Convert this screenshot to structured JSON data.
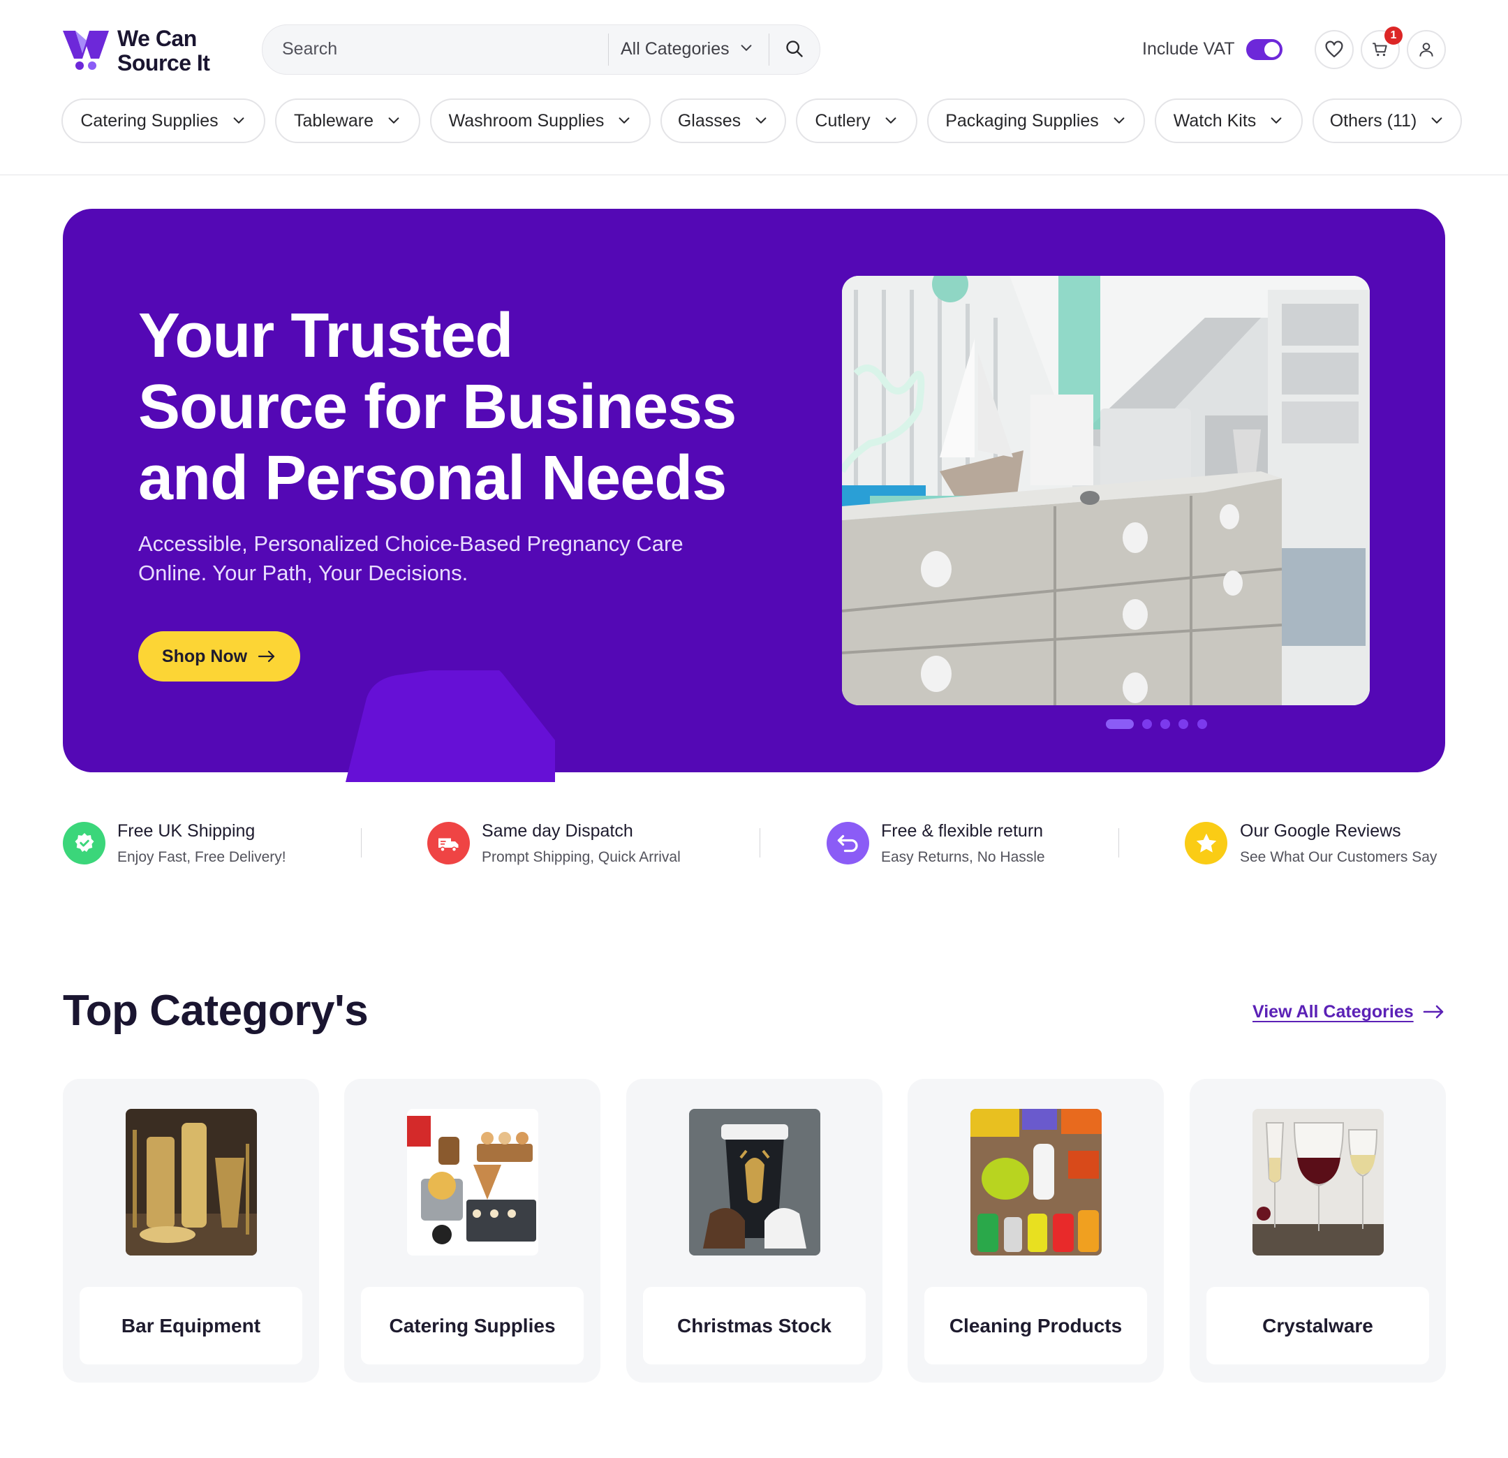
{
  "brand": {
    "name_line1": "We Can",
    "name_line2": "Source It",
    "primary_color": "#5408b5",
    "accent_color": "#fcd535"
  },
  "search": {
    "placeholder": "Search",
    "category_label": "All Categories"
  },
  "header": {
    "vat_label": "Include VAT",
    "vat_enabled": true,
    "cart_count": "1"
  },
  "nav": {
    "items": [
      {
        "label": "Catering Supplies"
      },
      {
        "label": "Tableware"
      },
      {
        "label": "Washroom Supplies"
      },
      {
        "label": "Glasses"
      },
      {
        "label": "Cutlery"
      },
      {
        "label": "Packaging Supplies"
      },
      {
        "label": "Watch Kits"
      },
      {
        "label": "Others (11)"
      }
    ]
  },
  "hero": {
    "title_line1": "Your Trusted",
    "title_line2": "Source for Business",
    "title_line3": "and Personal Needs",
    "subtitle_line1": "Accessible, Personalized Choice-Based Pregnancy Care",
    "subtitle_line2": "Online. Your Path, Your Decisions.",
    "cta_label": "Shop Now",
    "slides_total": 5,
    "active_slide": 1
  },
  "features": [
    {
      "title": "Free UK Shipping",
      "subtitle": "Enjoy Fast, Free Delivery!",
      "icon": "badge-check-icon",
      "color": "#3bd67a"
    },
    {
      "title": "Same  day Dispatch",
      "subtitle": "Prompt Shipping, Quick Arrival",
      "icon": "truck-icon",
      "color": "#ef4444"
    },
    {
      "title": "Free & flexible return",
      "subtitle": "Easy Returns, No Hassle",
      "icon": "return-icon",
      "color": "#8b5cf6"
    },
    {
      "title": "Our Google Reviews",
      "subtitle": "See What Our Customers Say",
      "icon": "star-icon",
      "color": "#facc15"
    }
  ],
  "top_categories": {
    "title": "Top Category's",
    "view_all_label": "View All Categories",
    "items": [
      {
        "label": "Bar Equipment"
      },
      {
        "label": "Catering Supplies"
      },
      {
        "label": "Christmas Stock"
      },
      {
        "label": "Cleaning Products"
      },
      {
        "label": "Crystalware"
      }
    ]
  }
}
